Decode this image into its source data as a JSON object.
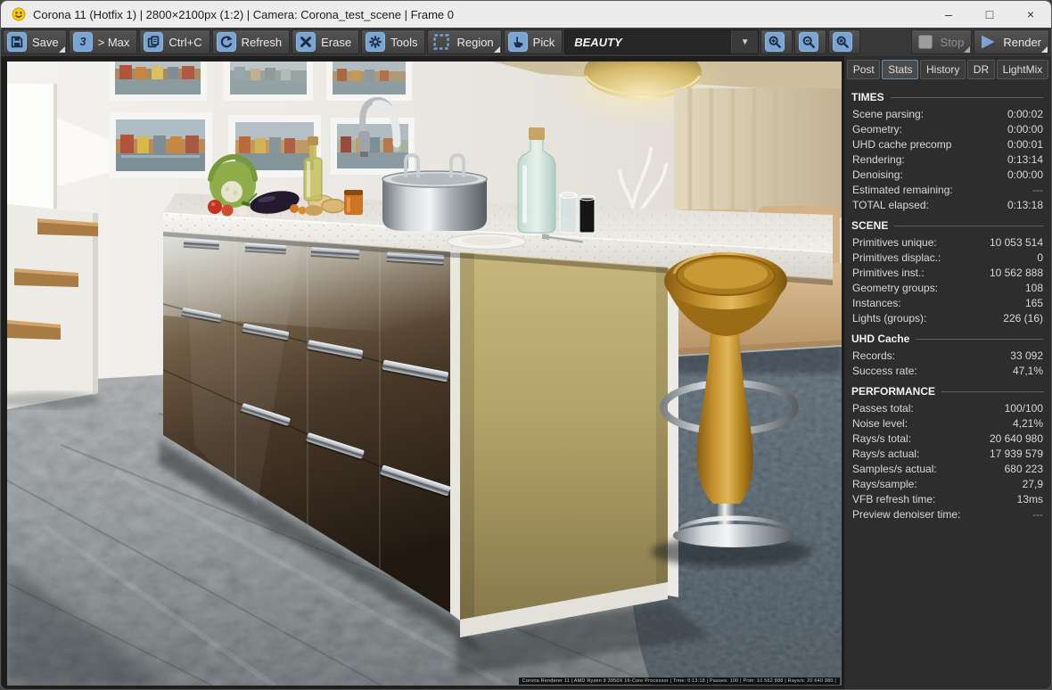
{
  "window": {
    "title": "Corona 11 (Hotfix 1) | 2800×2100px (1:2) | Camera: Corona_test_scene | Frame 0",
    "controls": {
      "minimize": "–",
      "maximize": "□",
      "close": "×"
    }
  },
  "toolbar": {
    "save": "Save",
    "max": "> Max",
    "copy": "Ctrl+C",
    "refresh": "Refresh",
    "erase": "Erase",
    "tools": "Tools",
    "region": "Region",
    "pick": "Pick",
    "render_element": "BEAUTY",
    "stop": "Stop",
    "render": "Render"
  },
  "panel": {
    "tabs": [
      "Post",
      "Stats",
      "History",
      "DR",
      "LightMix"
    ],
    "active_tab": "Stats",
    "sections": [
      {
        "title": "TIMES",
        "rows": [
          {
            "label": "Scene parsing:",
            "value": "0:00:02"
          },
          {
            "label": "Geometry:",
            "value": "0:00:00"
          },
          {
            "label": "UHD cache precomp",
            "value": "0:00:01"
          },
          {
            "label": "Rendering:",
            "value": "0:13:14"
          },
          {
            "label": "Denoising:",
            "value": "0:00:00"
          },
          {
            "label": "Estimated remaining:",
            "value": "---"
          },
          {
            "label": "TOTAL elapsed:",
            "value": "0:13:18"
          }
        ]
      },
      {
        "title": "SCENE",
        "rows": [
          {
            "label": "Primitives unique:",
            "value": "10 053 514"
          },
          {
            "label": "Primitives displac.:",
            "value": "0"
          },
          {
            "label": "Primitives inst.:",
            "value": "10 562 888"
          },
          {
            "label": "Geometry groups:",
            "value": "108"
          },
          {
            "label": "Instances:",
            "value": "165"
          },
          {
            "label": "Lights (groups):",
            "value": "226 (16)"
          }
        ]
      },
      {
        "title": "UHD Cache",
        "rows": [
          {
            "label": "Records:",
            "value": "33 092"
          },
          {
            "label": "Success rate:",
            "value": "47,1%"
          }
        ]
      },
      {
        "title": "PERFORMANCE",
        "rows": [
          {
            "label": "Passes total:",
            "value": "100/100"
          },
          {
            "label": "Noise level:",
            "value": "4,21%"
          },
          {
            "label": "Rays/s total:",
            "value": "20 640 980"
          },
          {
            "label": "Rays/s actual:",
            "value": "17 939 579"
          },
          {
            "label": "Samples/s actual:",
            "value": "680 223"
          },
          {
            "label": "Rays/sample:",
            "value": "27,9"
          },
          {
            "label": "VFB refresh time:",
            "value": "13ms"
          },
          {
            "label": "Preview denoiser time:",
            "value": "---"
          }
        ]
      }
    ]
  },
  "viewport": {
    "stamp": "Corona Renderer 11 | AMD Ryzen 9 3950X 16-Core Processor | Time: 0:13:18 | Passes: 100 | Prim: 10 562 888 | Rays/s: 20 640 980 |"
  },
  "icons": {
    "smiley-icon": "corona smiley logo",
    "save-icon": "floppy disk",
    "3dsmax-icon": "3",
    "copy-icon": "two documents",
    "refresh-icon": "circular arrow",
    "erase-icon": "cross",
    "tools-gear-icon": "gear",
    "region-icon": "dashed rectangle",
    "pick-hand-icon": "hand",
    "chevron-down-icon": "▼",
    "zoom-in-icon": "magnifier plus",
    "zoom-out-icon": "magnifier minus",
    "zoom-reset-icon": "magnifier cross",
    "stop-icon": "gray square",
    "render-play-icon": "blue triangle"
  },
  "colors": {
    "accent_blue": "#7aa5d2",
    "toolbar_bg": "#383838",
    "panel_bg": "#2d2d2d",
    "titlebar_bg": "#ececec",
    "tab_active_border": "#5b8fc0",
    "gold_cabinet": "#b3a369",
    "brown_gloss": "#4a3a28",
    "stool_amber": "#c08a28"
  }
}
